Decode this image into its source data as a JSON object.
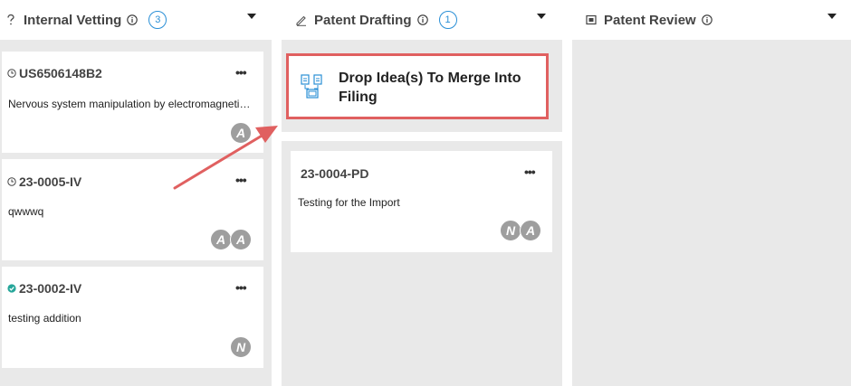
{
  "columns": [
    {
      "title": "Internal Vetting",
      "count": "3",
      "icon": "question-icon"
    },
    {
      "title": "Patent Drafting",
      "count": "1",
      "icon": "pencil-icon"
    },
    {
      "title": "Patent Review",
      "icon": "review-icon"
    }
  ],
  "vetting_cards": [
    {
      "id": "US6506148B2",
      "desc": "Nervous system manipulation by electromagnetic fields from monitors",
      "status_icon": "clock-icon",
      "avatars": [
        "A"
      ]
    },
    {
      "id": "23-0005-IV",
      "desc": "qwwwq",
      "status_icon": "clock-icon",
      "avatars": [
        "A",
        "A"
      ]
    },
    {
      "id": "23-0002-IV",
      "desc": "testing addition",
      "status_icon": "check-circle-icon",
      "avatars": [
        "N"
      ]
    }
  ],
  "drop_zone": {
    "label": "Drop Idea(s) To Merge Into Filing",
    "icon": "merge-documents-icon"
  },
  "drafting_card": {
    "id": "23-0004-PD",
    "desc": "Testing for the Import",
    "avatars": [
      "N",
      "A"
    ]
  },
  "more_label": "•••",
  "colors": {
    "accent": "#2a8fd6",
    "highlight": "#e06060",
    "check": "#26a69a",
    "avatar": "#9e9e9e"
  }
}
